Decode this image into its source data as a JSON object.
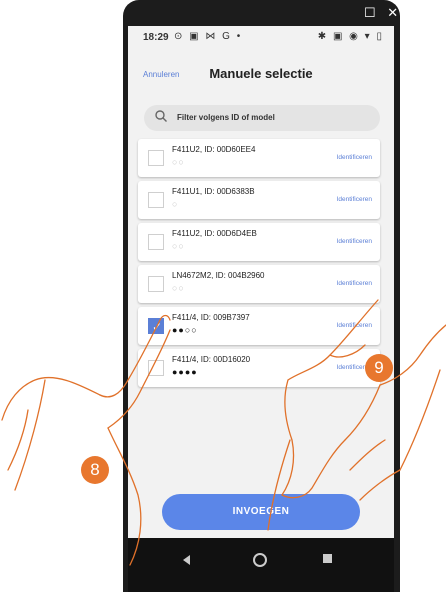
{
  "corner_icons": "☐ ✕",
  "status_bar": {
    "time": "18:29",
    "left_icons": "⊙ ▣ ⋈ G •",
    "right_icons": "✱ ▣ ◉ ▾ ▯"
  },
  "header": {
    "cancel_label": "Annuleren",
    "title": "Manuele selectie"
  },
  "search": {
    "placeholder": "Filter volgens ID of model"
  },
  "identify_label": "Identificeren",
  "devices": [
    {
      "label": "F411U2, ID: 00D60EE4",
      "dots": "○○",
      "dark": false,
      "checked": false
    },
    {
      "label": "F411U1, ID: 00D6383B",
      "dots": "○",
      "dark": false,
      "checked": false
    },
    {
      "label": "F411U2, ID: 00D6D4EB",
      "dots": "○○",
      "dark": false,
      "checked": false
    },
    {
      "label": "LN4672M2, ID: 004B2960",
      "dots": "○○",
      "dark": false,
      "checked": false
    },
    {
      "label": "F411/4, ID: 009B7397",
      "dots": "●●○○",
      "dark": true,
      "checked": true
    },
    {
      "label": "F411/4, ID: 00D16020",
      "dots": "●●●●",
      "dark": true,
      "checked": false
    }
  ],
  "insert_button": "INVOEGEN",
  "step_badges": [
    "8",
    "9"
  ],
  "colors": {
    "accent": "#5b86e8",
    "badge": "#e8772e"
  }
}
